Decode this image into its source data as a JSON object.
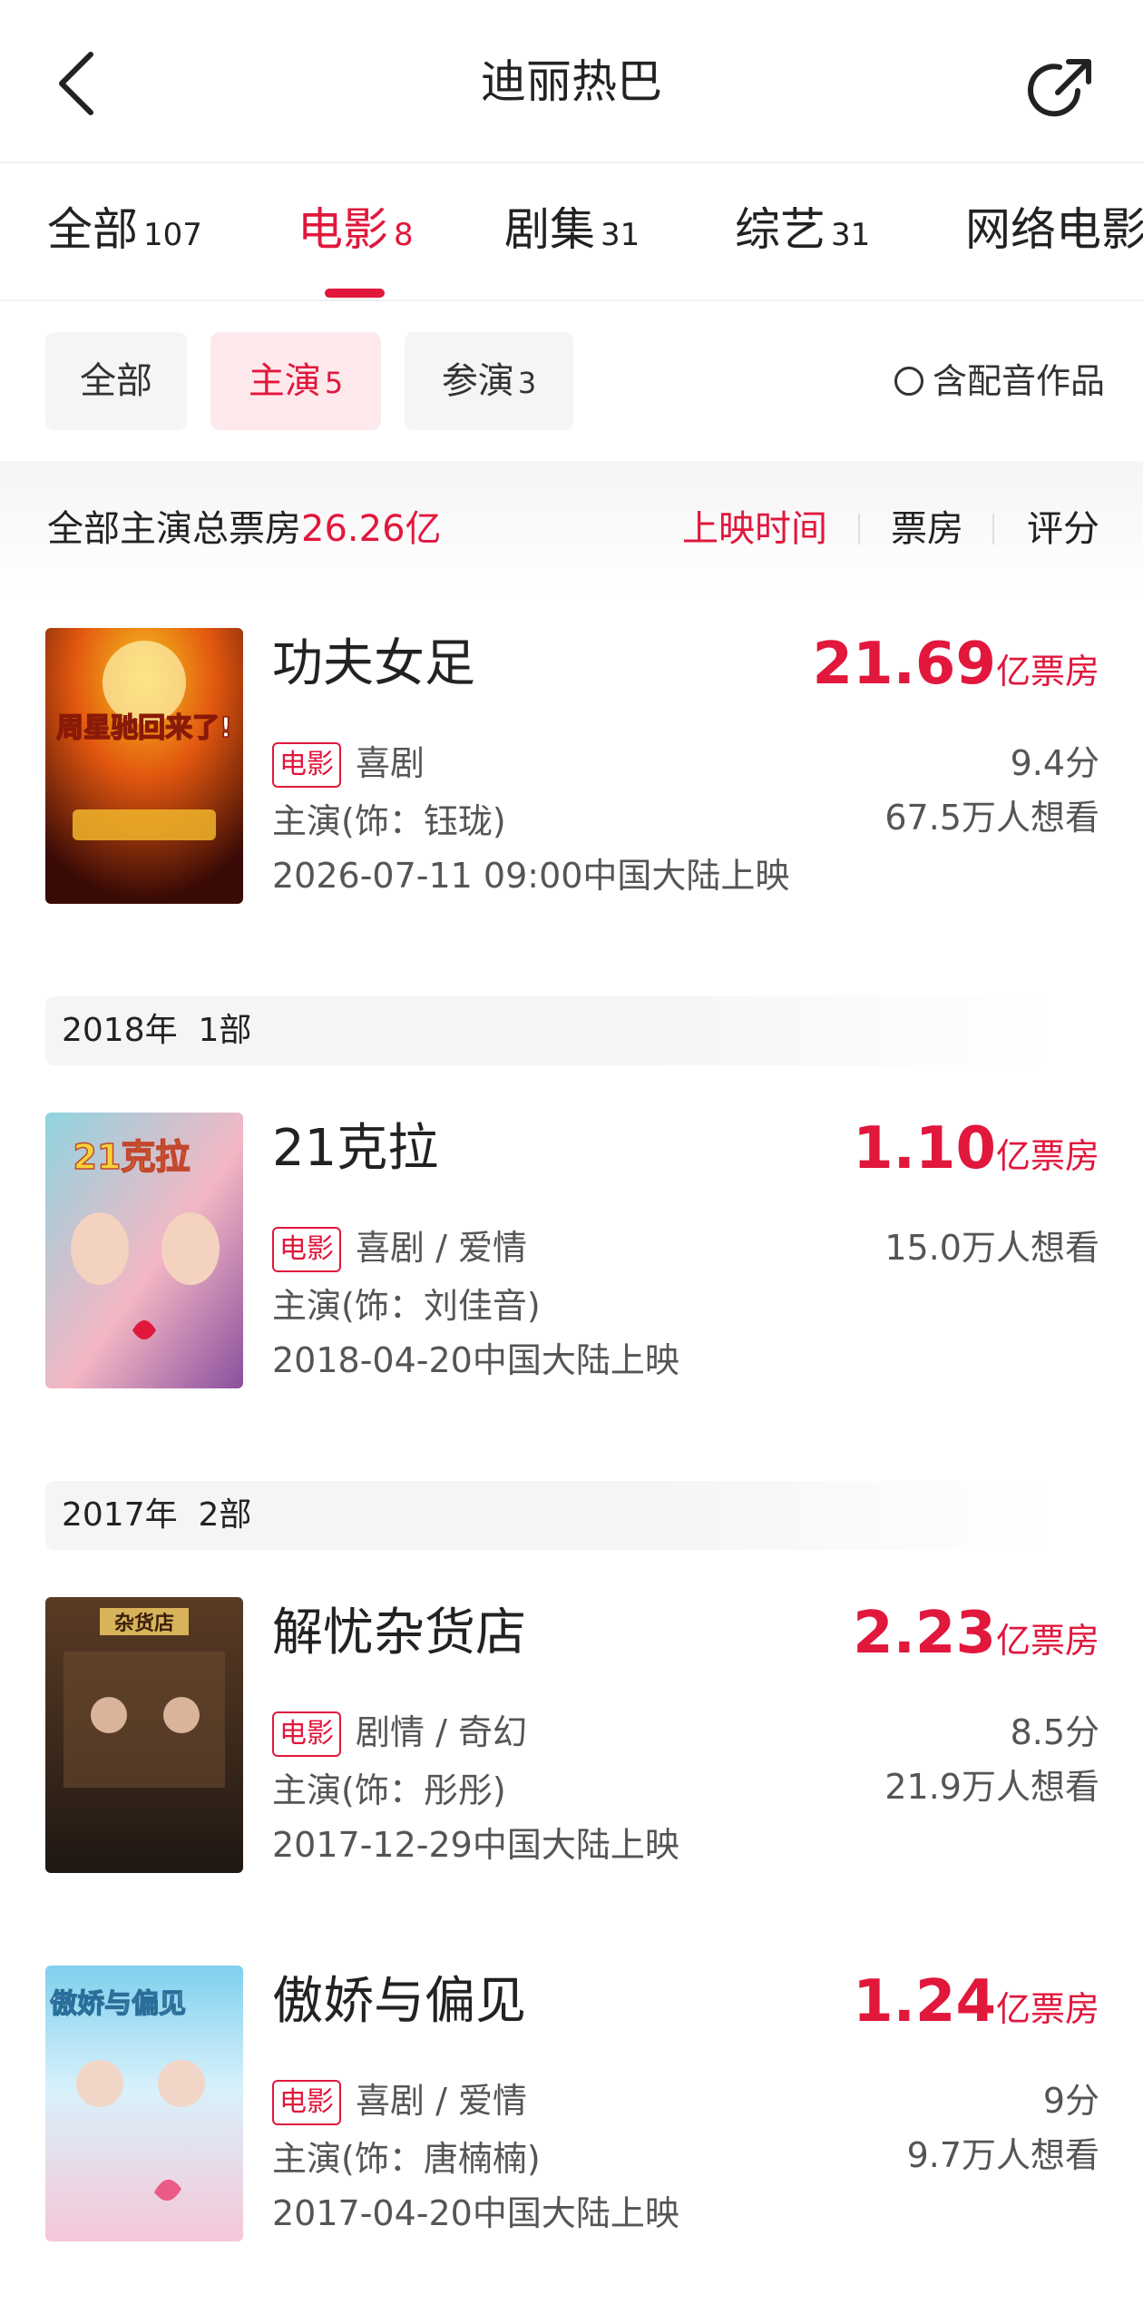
{
  "header": {
    "title": "迪丽热巴"
  },
  "tabs": [
    {
      "label": "全部",
      "count": "107"
    },
    {
      "label": "电影",
      "count": "8"
    },
    {
      "label": "剧集",
      "count": "31"
    },
    {
      "label": "综艺",
      "count": "31"
    },
    {
      "label": "网络电影",
      "count": ""
    }
  ],
  "filters": {
    "chips": [
      {
        "label": "全部",
        "count": ""
      },
      {
        "label": "主演",
        "count": "5"
      },
      {
        "label": "参演",
        "count": "3"
      }
    ],
    "dubbing_label": "含配音作品"
  },
  "summary": {
    "label": "全部主演总票房",
    "value": "26.26亿",
    "sorts": [
      "上映时间",
      "票房",
      "评分"
    ]
  },
  "groups": [
    {
      "year": "2018年",
      "count": "1部"
    },
    {
      "year": "2017年",
      "count": "2部"
    }
  ],
  "movies": [
    {
      "title": "功夫女足",
      "box_value": "21.69",
      "box_unit": "亿票房",
      "tag": "电影",
      "genre": "喜剧",
      "role": "主演(饰：钰珑)",
      "release": "2026-07-11 09:00中国大陆上映",
      "rating": "9.4分",
      "wish": "67.5万人想看",
      "poster_text": "周星驰回来了!",
      "poster_colors": [
        "#f7c21e",
        "#e2570f",
        "#3a0b06"
      ]
    },
    {
      "title": "21克拉",
      "box_value": "1.10",
      "box_unit": "亿票房",
      "tag": "电影",
      "genre": "喜剧 / 爱情",
      "role": "主演(饰：刘佳音)",
      "release": "2018-04-20中国大陆上映",
      "rating": "",
      "wish": "15.0万人想看",
      "poster_text": "21克拉",
      "poster_colors": [
        "#8fd4df",
        "#f3b7c4",
        "#8a4f9e"
      ]
    },
    {
      "title": "解忧杂货店",
      "box_value": "2.23",
      "box_unit": "亿票房",
      "tag": "电影",
      "genre": "剧情 / 奇幻",
      "role": "主演(饰：彤彤)",
      "release": "2017-12-29中国大陆上映",
      "rating": "8.5分",
      "wish": "21.9万人想看",
      "poster_text": "杂货店",
      "poster_colors": [
        "#5a3b24",
        "#3d2a1c",
        "#1f1712"
      ]
    },
    {
      "title": "傲娇与偏见",
      "box_value": "1.24",
      "box_unit": "亿票房",
      "tag": "电影",
      "genre": "喜剧 / 爱情",
      "role": "主演(饰：唐楠楠)",
      "release": "2017-04-20中国大陆上映",
      "rating": "9分",
      "wish": "9.7万人想看",
      "poster_text": "傲娇与偏见",
      "poster_colors": [
        "#7fd0ee",
        "#d8f1fb",
        "#f6c6d8"
      ]
    }
  ]
}
